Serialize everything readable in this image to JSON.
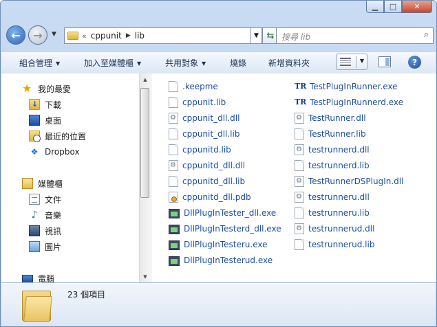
{
  "address": {
    "overflow": "«",
    "segments": [
      "cppunit",
      "lib"
    ]
  },
  "search": {
    "placeholder": "搜尋 lib"
  },
  "toolbar": {
    "organize": "組合管理",
    "add_to_library": "加入至媒體櫃",
    "share_with": "共用對象",
    "burn": "燒錄",
    "new_folder": "新增資料夾"
  },
  "nav": {
    "favorites": "我的最愛",
    "downloads": "下載",
    "desktop": "桌面",
    "recent_places": "最近的位置",
    "dropbox": "Dropbox",
    "libraries": "媒體櫃",
    "documents": "文件",
    "music": "音樂",
    "videos": "視訊",
    "pictures": "圖片",
    "computer": "電腦"
  },
  "files": {
    "col1": [
      {
        "name": ".keepme",
        "icon": "blank-file-icon"
      },
      {
        "name": "cppunit.lib",
        "icon": "blank-file-icon"
      },
      {
        "name": "cppunit_dll.dll",
        "icon": "dll-file-icon"
      },
      {
        "name": "cppunit_dll.lib",
        "icon": "blank-file-icon"
      },
      {
        "name": "cppunitd.lib",
        "icon": "blank-file-icon"
      },
      {
        "name": "cppunitd_dll.dll",
        "icon": "dll-file-icon"
      },
      {
        "name": "cppunitd_dll.lib",
        "icon": "blank-file-icon"
      },
      {
        "name": "cppunitd_dll.pdb",
        "icon": "pdb-file-icon"
      },
      {
        "name": "DllPlugInTester_dll.exe",
        "icon": "exe-file-icon"
      },
      {
        "name": "DllPlugInTesterd_dll.exe",
        "icon": "exe-file-icon"
      },
      {
        "name": "DllPlugInTesteru.exe",
        "icon": "exe-file-icon"
      },
      {
        "name": "DllPlugInTesterud.exe",
        "icon": "exe-file-icon"
      }
    ],
    "col2": [
      {
        "name": "TestPlugInRunner.exe",
        "icon": "testrunner-exe-icon"
      },
      {
        "name": "TestPlugInRunnerd.exe",
        "icon": "testrunner-exe-icon"
      },
      {
        "name": "TestRunner.dll",
        "icon": "dll-file-icon"
      },
      {
        "name": "TestRunner.lib",
        "icon": "blank-file-icon"
      },
      {
        "name": "testrunnerd.dll",
        "icon": "dll-file-icon"
      },
      {
        "name": "testrunnerd.lib",
        "icon": "blank-file-icon"
      },
      {
        "name": "TestRunnerDSPlugIn.dll",
        "icon": "dll-file-icon"
      },
      {
        "name": "testrunneru.dll",
        "icon": "dll-file-icon"
      },
      {
        "name": "testrunneru.lib",
        "icon": "blank-file-icon"
      },
      {
        "name": "testrunnerud.dll",
        "icon": "dll-file-icon"
      },
      {
        "name": "testrunnerud.lib",
        "icon": "blank-file-icon"
      }
    ]
  },
  "status": {
    "item_count": "23 個項目"
  },
  "colors": {
    "file_text": "#1c4ea8",
    "toolbar_text": "#1e3556"
  }
}
